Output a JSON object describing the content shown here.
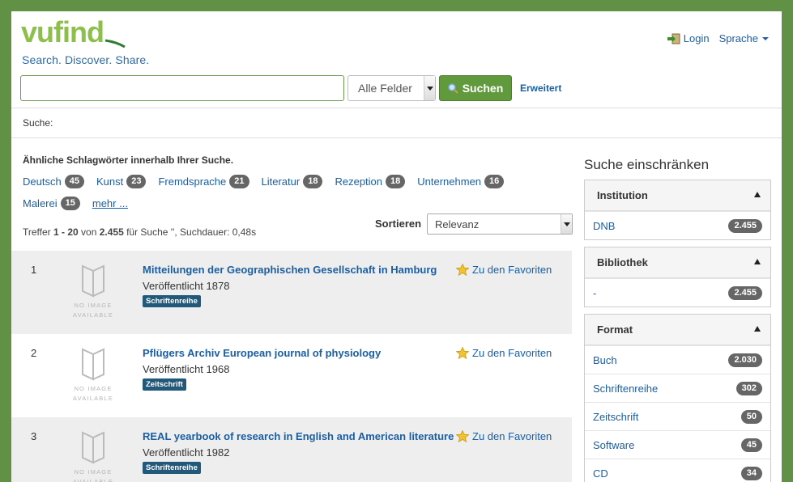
{
  "header": {
    "logo_text": "vufind",
    "slogan": "Search. Discover. Share.",
    "login_label": "Login",
    "language_label": "Sprache"
  },
  "search": {
    "query_value": "",
    "field_selected": "Alle Felder",
    "search_button": "Suchen",
    "advanced_link": "Erweitert"
  },
  "breadcrumb": "Suche:",
  "related": {
    "title": "Ähnliche Schlagwörter innerhalb Ihrer Suche.",
    "tags": [
      {
        "label": "Deutsch",
        "count": "45"
      },
      {
        "label": "Kunst",
        "count": "23"
      },
      {
        "label": "Fremdsprache",
        "count": "21"
      },
      {
        "label": "Literatur",
        "count": "18"
      },
      {
        "label": "Rezeption",
        "count": "18"
      },
      {
        "label": "Unternehmen",
        "count": "16"
      },
      {
        "label": "Malerei",
        "count": "15"
      }
    ],
    "more_label": "mehr ..."
  },
  "sort": {
    "label": "Sortieren",
    "selected": "Relevanz"
  },
  "stats": {
    "prefix": "Treffer ",
    "range": "1 - 20",
    "of": " von ",
    "total": "2.455",
    "suffix": " für Suche '', Suchdauer: 0,48s"
  },
  "results": [
    {
      "num": "1",
      "title": "Mitteilungen der Geographischen Gesellschaft in Hamburg",
      "published": "Veröffentlicht 1878",
      "format": "Schriftenreihe",
      "fav": "Zu den Favoriten",
      "noimg": "NO IMAGE AVAILABLE"
    },
    {
      "num": "2",
      "title": "Pflügers Archiv European journal of physiology",
      "published": "Veröffentlicht 1968",
      "format": "Zeitschrift",
      "fav": "Zu den Favoriten",
      "noimg": "NO IMAGE AVAILABLE"
    },
    {
      "num": "3",
      "title": "REAL yearbook of research in English and American literature",
      "published": "Veröffentlicht 1982",
      "format": "Schriftenreihe",
      "fav": "Zu den Favoriten",
      "noimg": "NO IMAGE AVAILABLE"
    }
  ],
  "sidebar": {
    "title": "Suche einschränken",
    "facets": [
      {
        "name": "Institution",
        "items": [
          {
            "label": "DNB",
            "count": "2.455"
          }
        ]
      },
      {
        "name": "Bibliothek",
        "items": [
          {
            "label": "-",
            "count": "2.455"
          }
        ]
      },
      {
        "name": "Format",
        "items": [
          {
            "label": "Buch",
            "count": "2.030"
          },
          {
            "label": "Schriftenreihe",
            "count": "302"
          },
          {
            "label": "Zeitschrift",
            "count": "50"
          },
          {
            "label": "Software",
            "count": "45"
          },
          {
            "label": "CD",
            "count": "34"
          }
        ]
      }
    ]
  },
  "colors": {
    "brand_green": "#619144",
    "link_blue": "#1a5fa3",
    "badge_gray": "#666666",
    "format_label": "#22587a"
  },
  "icons": [
    "login-icon",
    "search-icon",
    "star-icon",
    "no-image-icon"
  ]
}
